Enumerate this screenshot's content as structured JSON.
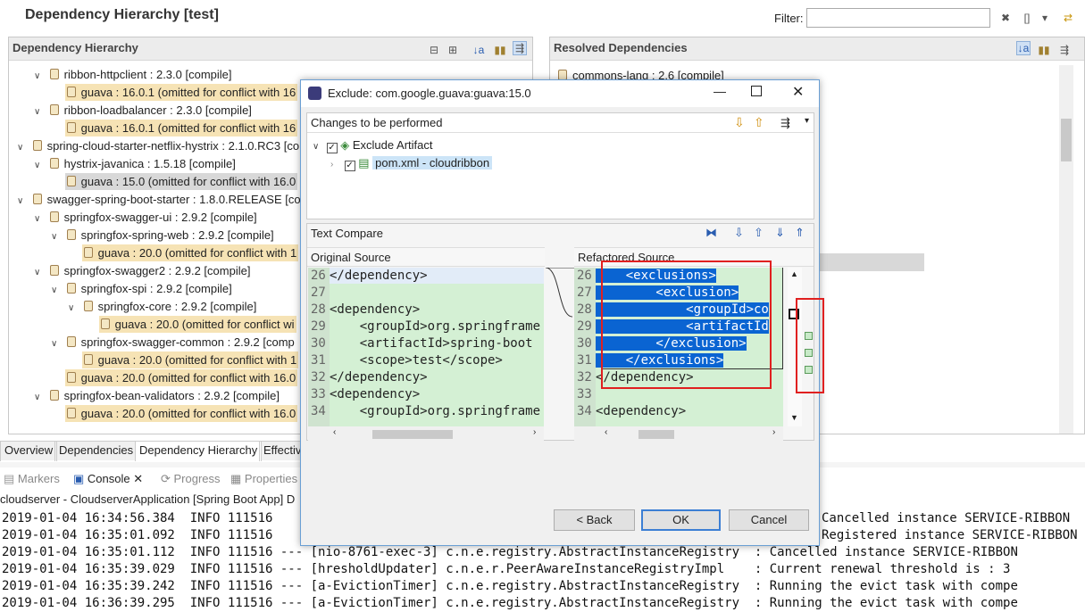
{
  "editor": {
    "title": "Dependency Hierarchy [test]",
    "filter_label": "Filter:"
  },
  "left_panel": {
    "title": "Dependency Hierarchy",
    "items": [
      {
        "text": "ribbon-httpclient : 2.3.0 [compile]"
      },
      {
        "text": "guava : 16.0.1 (omitted for conflict with 16"
      },
      {
        "text": "ribbon-loadbalancer : 2.3.0 [compile]"
      },
      {
        "text": "guava : 16.0.1 (omitted for conflict with 16"
      },
      {
        "text": "spring-cloud-starter-netflix-hystrix : 2.1.0.RC3 [co"
      },
      {
        "text": "hystrix-javanica : 1.5.18 [compile]"
      },
      {
        "text": "guava : 15.0 (omitted for conflict with 16.0"
      },
      {
        "text": "swagger-spring-boot-starter : 1.8.0.RELEASE [co"
      },
      {
        "text": "springfox-swagger-ui : 2.9.2 [compile]"
      },
      {
        "text": "springfox-spring-web : 2.9.2 [compile]"
      },
      {
        "text": "guava : 20.0 (omitted for conflict with 1"
      },
      {
        "text": "springfox-swagger2 : 2.9.2 [compile]"
      },
      {
        "text": "springfox-spi : 2.9.2 [compile]"
      },
      {
        "text": "springfox-core : 2.9.2 [compile]"
      },
      {
        "text": "guava : 20.0 (omitted for conflict wi"
      },
      {
        "text": "springfox-swagger-common : 2.9.2 [comp"
      },
      {
        "text": "guava : 20.0 (omitted for conflict with 1"
      },
      {
        "text": "guava : 20.0 (omitted for conflict with 16.0"
      },
      {
        "text": "springfox-bean-validators : 2.9.2 [compile]"
      },
      {
        "text": "guava : 20.0 (omitted for conflict with 16.0"
      }
    ]
  },
  "right_panel": {
    "title": "Resolved Dependencies",
    "first_item": "commons-lang : 2.6 [compile]"
  },
  "bottom_tabs": [
    "Overview",
    "Dependencies",
    "Dependency Hierarchy",
    "Effectiv"
  ],
  "console": {
    "tabs": [
      "Markers",
      "Console",
      "Progress",
      "Properties"
    ],
    "launch": "cloudserver - CloudserverApplication [Spring Boot App] D",
    "lines": [
      "2019-01-04 16:34:56.384  INFO 111516",
      "2019-01-04 16:35:01.092  INFO 111516",
      "2019-01-04 16:35:01.112  INFO 111516 --- [nio-8761-exec-3] c.n.e.registry.AbstractInstanceRegistry  : Cancelled instance SERVICE-RIBBON",
      "2019-01-04 16:35:39.029  INFO 111516 --- [hresholdUpdater] c.n.e.r.PeerAwareInstanceRegistryImpl    : Current renewal threshold is : 3",
      "2019-01-04 16:35:39.242  INFO 111516 --- [a-EvictionTimer] c.n.e.registry.AbstractInstanceRegistry  : Running the evict task with compe",
      "2019-01-04 16:36:39.295  INFO 111516 --- [a-EvictionTimer] c.n.e.registry.AbstractInstanceRegistry  : Running the evict task with compe"
    ],
    "right_lines": [
      "Cancelled instance SERVICE-RIBBON",
      "Registered instance SERVICE-RIBBON"
    ]
  },
  "dialog": {
    "title": "Exclude: com.google.guava:guava:15.0",
    "changes_label": "Changes to be performed",
    "tree": [
      "Exclude Artifact",
      "pom.xml - cloudribbon"
    ],
    "compare_label": "Text Compare",
    "original_label": "Original Source",
    "refactored_label": "Refactored Source",
    "original": [
      {
        "n": "26",
        "t": "</dependency>"
      },
      {
        "n": "27",
        "t": ""
      },
      {
        "n": "28",
        "t": "<dependency>"
      },
      {
        "n": "29",
        "t": "    <groupId>org.springframe"
      },
      {
        "n": "30",
        "t": "    <artifactId>spring-boot"
      },
      {
        "n": "31",
        "t": "    <scope>test</scope>"
      },
      {
        "n": "32",
        "t": "</dependency>"
      },
      {
        "n": "33",
        "t": "<dependency>"
      },
      {
        "n": "34",
        "t": "    <groupId>org.springframe"
      }
    ],
    "refactored": [
      {
        "n": "26",
        "t": "    <exclusions>"
      },
      {
        "n": "27",
        "t": "        <exclusion>"
      },
      {
        "n": "28",
        "t": "            <groupId>co"
      },
      {
        "n": "29",
        "t": "            <artifactId"
      },
      {
        "n": "30",
        "t": "        </exclusion>"
      },
      {
        "n": "31",
        "t": "    </exclusions>"
      },
      {
        "n": "32",
        "t": "</dependency>"
      },
      {
        "n": "33",
        "t": ""
      },
      {
        "n": "34",
        "t": "<dependency>"
      }
    ],
    "buttons": {
      "back": "< Back",
      "ok": "OK",
      "cancel": "Cancel"
    }
  },
  "colors": {
    "diff_green": "#d4f0d4",
    "selection": "#0a64d2",
    "omitted": "#f6e3b5",
    "annotation": "#e02020"
  }
}
